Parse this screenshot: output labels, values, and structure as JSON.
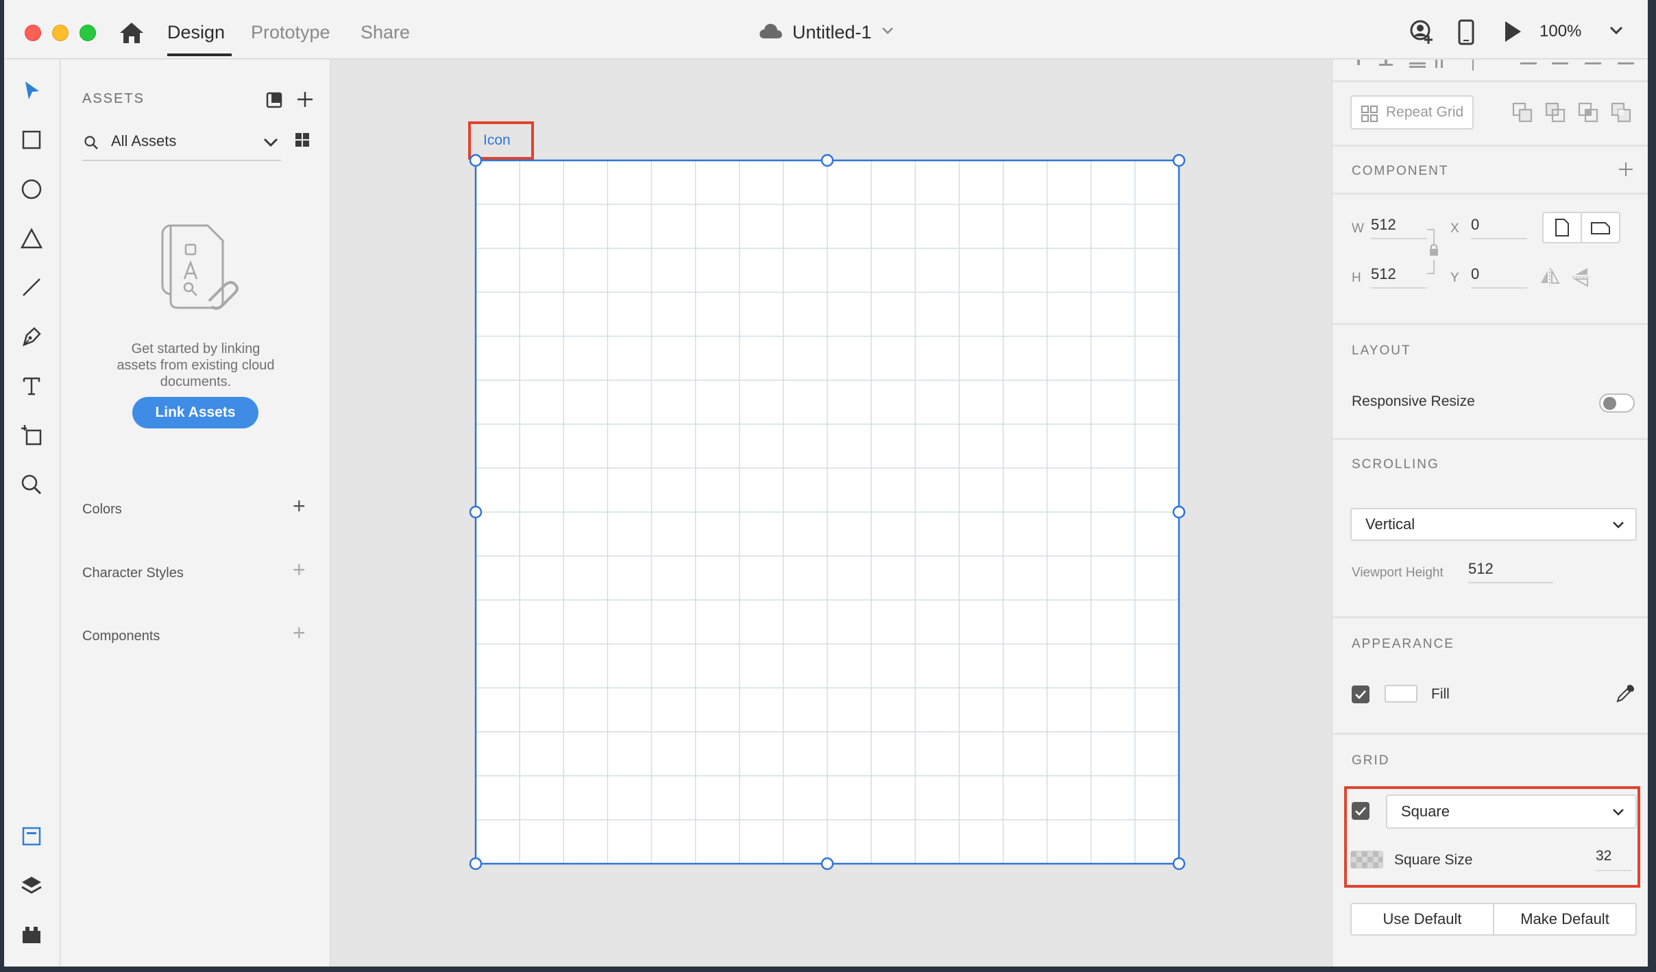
{
  "titlebar": {
    "tabs": [
      {
        "label": "Design",
        "active": true
      },
      {
        "label": "Prototype",
        "active": false
      },
      {
        "label": "Share",
        "active": false
      }
    ],
    "document_title": "Untitled-1",
    "zoom": "100%"
  },
  "tools": [
    "select-icon",
    "rectangle-icon",
    "ellipse-icon",
    "triangle-icon",
    "line-icon",
    "pen-icon",
    "text-icon",
    "artboard-icon",
    "zoom-icon"
  ],
  "assets": {
    "title": "ASSETS",
    "filter": "All Assets",
    "empty_message": "Get started by linking assets from existing cloud documents.",
    "link_button": "Link Assets",
    "sections": [
      "Colors",
      "Character Styles",
      "Components"
    ]
  },
  "canvas": {
    "artboard_name": "Icon",
    "grid_columns": 16,
    "grid_rows": 16
  },
  "inspector": {
    "repeat_grid": "Repeat Grid",
    "component_title": "COMPONENT",
    "w_label": "W",
    "w_value": "512",
    "h_label": "H",
    "h_value": "512",
    "x_label": "X",
    "x_value": "0",
    "y_label": "Y",
    "y_value": "0",
    "layout_title": "LAYOUT",
    "responsive_resize": "Responsive Resize",
    "responsive_on": false,
    "scrolling_title": "SCROLLING",
    "scrolling_value": "Vertical",
    "viewport_label": "Viewport Height",
    "viewport_value": "512",
    "appearance_title": "APPEARANCE",
    "fill_label": "Fill",
    "fill_color": "#ffffff",
    "grid_title": "GRID",
    "grid_type": "Square",
    "square_size_label": "Square Size",
    "square_size_value": "32",
    "use_default": "Use Default",
    "make_default": "Make Default"
  },
  "colors": {
    "accent": "#3e8ce6",
    "selection": "#2e75d6",
    "highlight": "#e0432e"
  }
}
